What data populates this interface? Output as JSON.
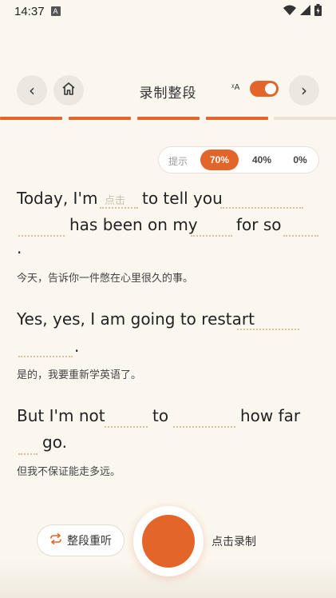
{
  "status": {
    "time": "14:37",
    "a_badge": "A"
  },
  "nav": {
    "back_glyph": "‹",
    "forward_glyph": "›",
    "title": "录制整段",
    "translate_glyph": "ᵡA",
    "translate_on": true
  },
  "progress": {
    "segments_done": 4,
    "segments_total": 5,
    "accent": "#e2652a",
    "rest": "#ebe2d3"
  },
  "hint": {
    "label": "提示",
    "options": [
      "70%",
      "40%",
      "0%"
    ],
    "selected": "70%"
  },
  "sentences": [
    {
      "lines": [
        "Today, I'm",
        "to tell you",
        "has been on my",
        "for so",
        "."
      ],
      "blank_hint": "点击",
      "translation": "今天，告诉你一件憋在心里很久的事。"
    },
    {
      "lines": [
        "Yes, yes, I am going to restart",
        "."
      ],
      "translation": "是的，我要重新学英语了。"
    },
    {
      "lines": [
        "But I'm not",
        "to",
        "how far",
        "go."
      ],
      "translation": "但我不保证能走多远。"
    }
  ],
  "controls": {
    "replay_label": "整段重听",
    "record_label": "点击录制"
  }
}
